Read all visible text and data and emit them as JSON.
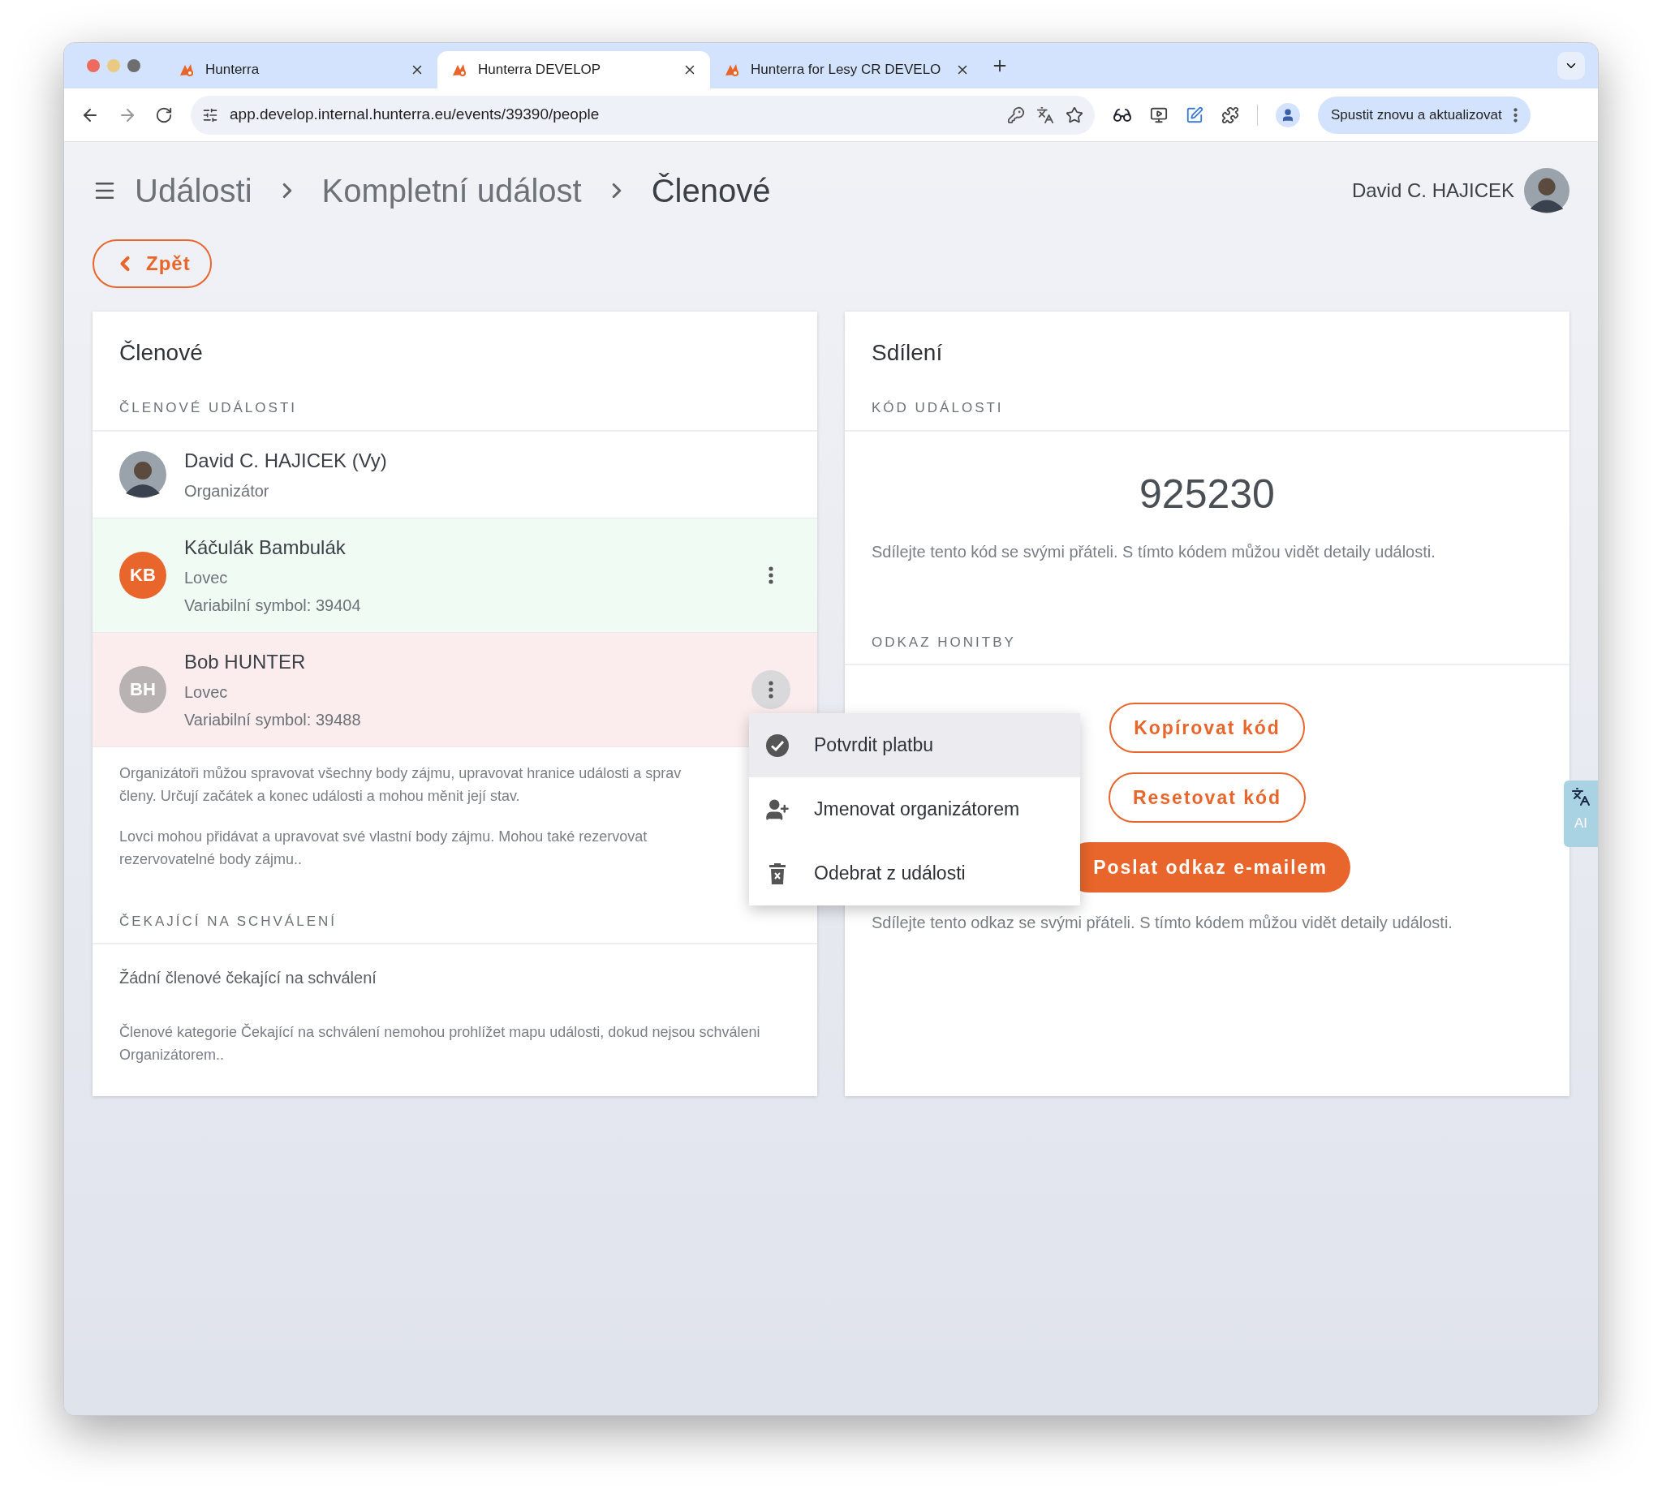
{
  "browser": {
    "tabs": [
      {
        "title": "Hunterra",
        "selected": false
      },
      {
        "title": "Hunterra DEVELOP",
        "selected": true
      },
      {
        "title": "Hunterra for Lesy CR DEVELO",
        "selected": false
      }
    ],
    "url": "app.develop.internal.hunterra.eu/events/39390/people",
    "update_button": "Spustit znovu a aktualizovat"
  },
  "breadcrumb": [
    "Události",
    "Kompletní událost",
    "Členové"
  ],
  "user": {
    "name": "David C. HAJICEK"
  },
  "back_button": "Zpět",
  "members_card": {
    "title": "Členové",
    "section": "ČLENOVÉ UDÁLOSTI",
    "members": [
      {
        "name": "David C. HAJICEK (Vy)",
        "role": "Organizátor",
        "kind": "photo",
        "color": "#ffffff"
      },
      {
        "name": "Káčulák Bambulák",
        "role": "Lovec",
        "symbol": "Variabilní symbol: 39404",
        "kind": "initials",
        "initials": "KB",
        "disabled": false,
        "color": "#effbf3",
        "menu_open": false
      },
      {
        "name": "Bob HUNTER",
        "role": "Lovec",
        "symbol": "Variabilní symbol: 39488",
        "kind": "initials",
        "initials": "BH",
        "disabled": true,
        "color": "#fbeded",
        "menu_open": true
      }
    ],
    "info_lines": [
      "Organizátoři můžou spravovat všechny body zájmu, upravovat hranice události a sprav",
      "členy. Určují začátek a konec události a mohou měnit její stav."
    ],
    "info_2": "Lovci mohou přidávat a upravovat své vlastní body zájmu. Mohou také rezervovat rezervovatelné body zájmu..",
    "pending_section": "ČEKAJÍCÍ NA SCHVÁLENÍ",
    "pending_empty": "Žádní členové čekající na schválení",
    "pending_info": "Členové kategorie Čekající na schválení nemohou prohlížet mapu události, dokud nejsou schváleni Organizátorem.."
  },
  "share_card": {
    "title": "Sdílení",
    "code_section": "KÓD UDÁLOSTI",
    "code": "925230",
    "code_info": "Sdílejte tento kód se svými přáteli. S tímto kódem můžou vidět detaily události.",
    "link_section": "ODKAZ HONITBY",
    "copy_button": "Kopírovat kód",
    "reset_button": "Resetovat kód",
    "email_button": "Poslat odkaz e-mailem",
    "link_info": "Sdílejte tento odkaz se svými přáteli. S tímto kódem můžou vidět detaily události."
  },
  "context_menu": [
    {
      "label": "Potvrdit platbu",
      "kind": "check",
      "selected": true
    },
    {
      "label": "Jmenovat organizátorem",
      "kind": "add-person",
      "selected": false
    },
    {
      "label": "Odebrat z události",
      "kind": "delete",
      "selected": false
    }
  ],
  "ai_widget": {
    "label": "AI"
  }
}
